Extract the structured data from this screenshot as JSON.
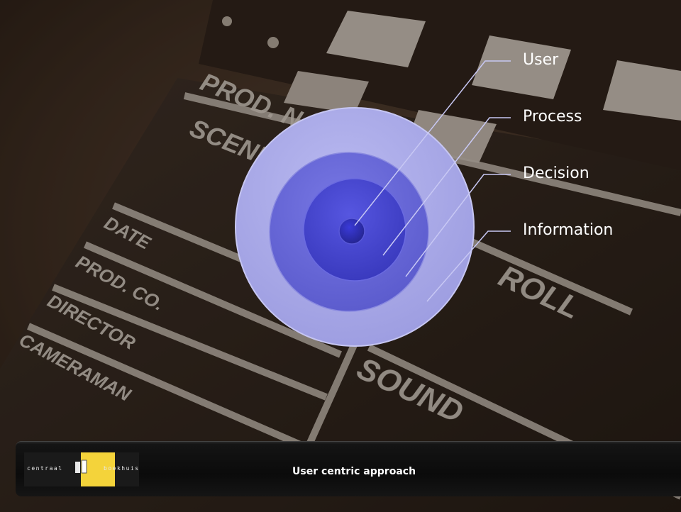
{
  "diagram": {
    "rings": [
      {
        "label": "User",
        "color": "#4242c0"
      },
      {
        "label": "Process",
        "color": "#4a4ad2"
      },
      {
        "label": "Decision",
        "color": "#6a6ad6"
      },
      {
        "label": "Information",
        "color": "#a6a6e6"
      }
    ]
  },
  "footer": {
    "logo": {
      "left_text": "centraal",
      "right_text": "boekhuis"
    },
    "title": "User centric approach"
  }
}
